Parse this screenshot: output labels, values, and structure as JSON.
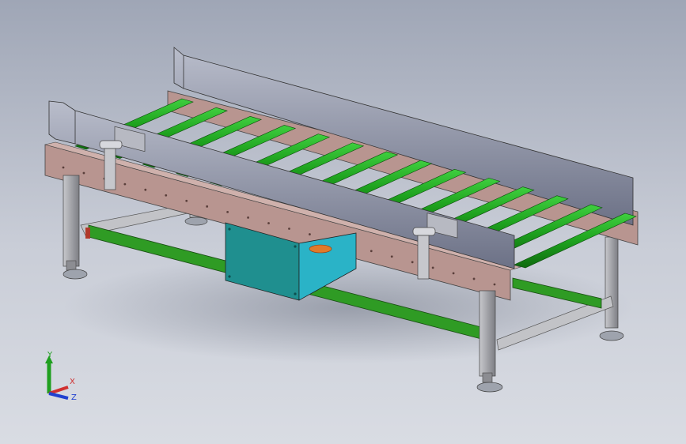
{
  "viewport": {
    "background_top": "#9fa6b6",
    "background_bottom": "#d9dce3"
  },
  "model": {
    "colors": {
      "frame_beam": "#b89590",
      "roller": "#1fa31f",
      "guard_rail": "#8d93a6",
      "leg": "#a9aaae",
      "stretcher": "#2f9b24",
      "control_box": "#1f8f8f",
      "foot_pad": "#9ea3ad",
      "motor": "#e07a2a"
    },
    "roller_count": 14
  },
  "triad": {
    "y_label": "Y",
    "x_label": "X",
    "z_label": "Z",
    "y_color": "#1f9f1f",
    "x_color": "#d03030",
    "z_color": "#2040d0"
  }
}
